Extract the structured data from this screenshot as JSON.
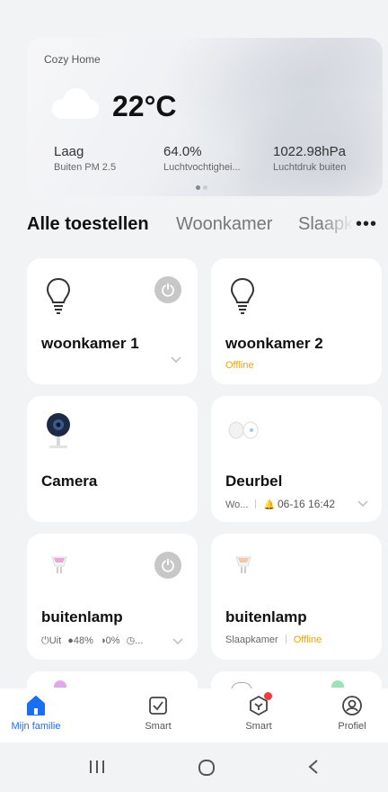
{
  "weather": {
    "home_name": "Cozy Home",
    "temperature": "22°C",
    "condition_icon": "cloud-icon",
    "stats": [
      {
        "value": "Laag",
        "label": "Buiten PM 2.5"
      },
      {
        "value": "64.0%",
        "label": "Luchtvochtighei..."
      },
      {
        "value": "1022.98hPa",
        "label": "Luchtdruk buiten"
      }
    ],
    "page_count": 2,
    "active_page": 1
  },
  "tabs": {
    "items": [
      "Alle toestellen",
      "Woonkamer",
      "Slaapkamer"
    ],
    "active": "Alle toestellen",
    "more_icon": "more-icon"
  },
  "devices": [
    {
      "name": "woonkamer 1",
      "icon": "bulb-icon",
      "has_power": true,
      "status": ""
    },
    {
      "name": "woonkamer 2",
      "icon": "bulb-icon",
      "has_power": false,
      "status": "Offline"
    },
    {
      "name": "Camera",
      "icon": "camera-icon",
      "has_power": false,
      "status": ""
    },
    {
      "name": "Deurbel",
      "icon": "doorbell-icon",
      "has_power": false,
      "room": "Wo...",
      "event": "06-16 16:42"
    },
    {
      "name": "buitenlamp",
      "icon": "spotlight-icon",
      "has_power": true,
      "state": "Uit",
      "brightness": "48%",
      "saturation": "0%",
      "timer": "..."
    },
    {
      "name": "buitenlamp",
      "icon": "spotlight-icon",
      "has_power": false,
      "room": "Slaapkamer",
      "status": "Offline"
    }
  ],
  "bottom_nav": [
    {
      "label": "Mijn familie",
      "icon": "home-icon",
      "active": true
    },
    {
      "label": "Smart",
      "icon": "checkbox-icon",
      "active": false
    },
    {
      "label": "Smart",
      "icon": "smart-scene-icon",
      "active": false,
      "badge": true
    },
    {
      "label": "Profiel",
      "icon": "profile-icon",
      "active": false
    }
  ],
  "colors": {
    "accent": "#1a6ef2",
    "offline": "#f0a30a",
    "background": "#f2f3f5",
    "badge": "#ef3b3b"
  }
}
